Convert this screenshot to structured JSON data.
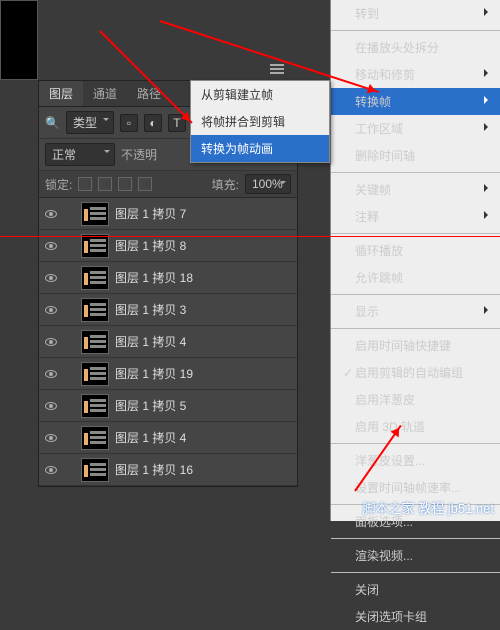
{
  "tabs": {
    "layers": "图层",
    "channels": "通道",
    "paths": "路径"
  },
  "toolbar": {
    "kind": "类型"
  },
  "blend": {
    "mode": "正常",
    "opacity_label": "不透明"
  },
  "lock": {
    "label": "锁定:",
    "fill_label": "填充:",
    "fill_value": "100%"
  },
  "layers": [
    {
      "name": "图层 1 拷贝 7"
    },
    {
      "name": "图层 1 拷贝 8"
    },
    {
      "name": "图层 1 拷贝 18"
    },
    {
      "name": "图层 1 拷贝 3"
    },
    {
      "name": "图层 1 拷贝 4"
    },
    {
      "name": "图层 1 拷贝 19"
    },
    {
      "name": "图层 1 拷贝 5"
    },
    {
      "name": "图层 1 拷贝 4"
    },
    {
      "name": "图层 1 拷贝 16"
    }
  ],
  "submenu": {
    "makeFrames": "从剪辑建立帧",
    "flatten": "将帧拼合到剪辑",
    "convert": "转换为帧动画"
  },
  "menu": {
    "goto": "转到",
    "splitAtPlayhead": "在播放头处拆分",
    "moveAndTrim": "移动和修剪",
    "convertFrames": "转换帧",
    "workArea": "工作区域",
    "deleteTimeline": "删除时间轴",
    "keyframes": "关键帧",
    "comments": "注释",
    "loop": "循环播放",
    "allowSkip": "允许跳帧",
    "show": "显示",
    "enableShortcuts": "启用时间轴快捷键",
    "enableAutoGroup": "启用剪辑的自动编组",
    "enableOnion": "启用洋葱皮",
    "enable3d": "启用 3D 轨道",
    "onionSettings": "洋葱皮设置...",
    "setFrameRate": "设置时间轴帧速率...",
    "panelOptions": "面板选项...",
    "renderVideo": "渲染视频...",
    "close": "关闭",
    "closeGroup": "关闭选项卡组"
  },
  "watermark": "脚本之家 教程 jb51.net"
}
